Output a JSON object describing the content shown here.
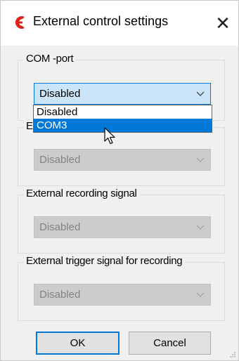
{
  "window": {
    "title": "External control settings",
    "close_glyph": "✕"
  },
  "groups": [
    {
      "label": "COM -port",
      "select_value": "Disabled",
      "enabled": true
    },
    {
      "label": "E",
      "select_value": "Disabled",
      "enabled": false
    },
    {
      "label": "External recording signal",
      "select_value": "Disabled",
      "enabled": false
    },
    {
      "label": "External trigger signal for recording",
      "select_value": "Disabled",
      "enabled": false
    }
  ],
  "dropdown": {
    "options": [
      "Disabled",
      "COM3"
    ],
    "highlighted": "COM3"
  },
  "buttons": {
    "ok": "OK",
    "cancel": "Cancel"
  },
  "colors": {
    "accent": "#0078d7",
    "app_icon": "#d9261c",
    "disabled_fill": "#cccccc"
  },
  "icons": {
    "app": "app-logo-icon",
    "close": "close-icon",
    "arrow": "chevron-down-icon",
    "cursor": "mouse-pointer-icon"
  }
}
